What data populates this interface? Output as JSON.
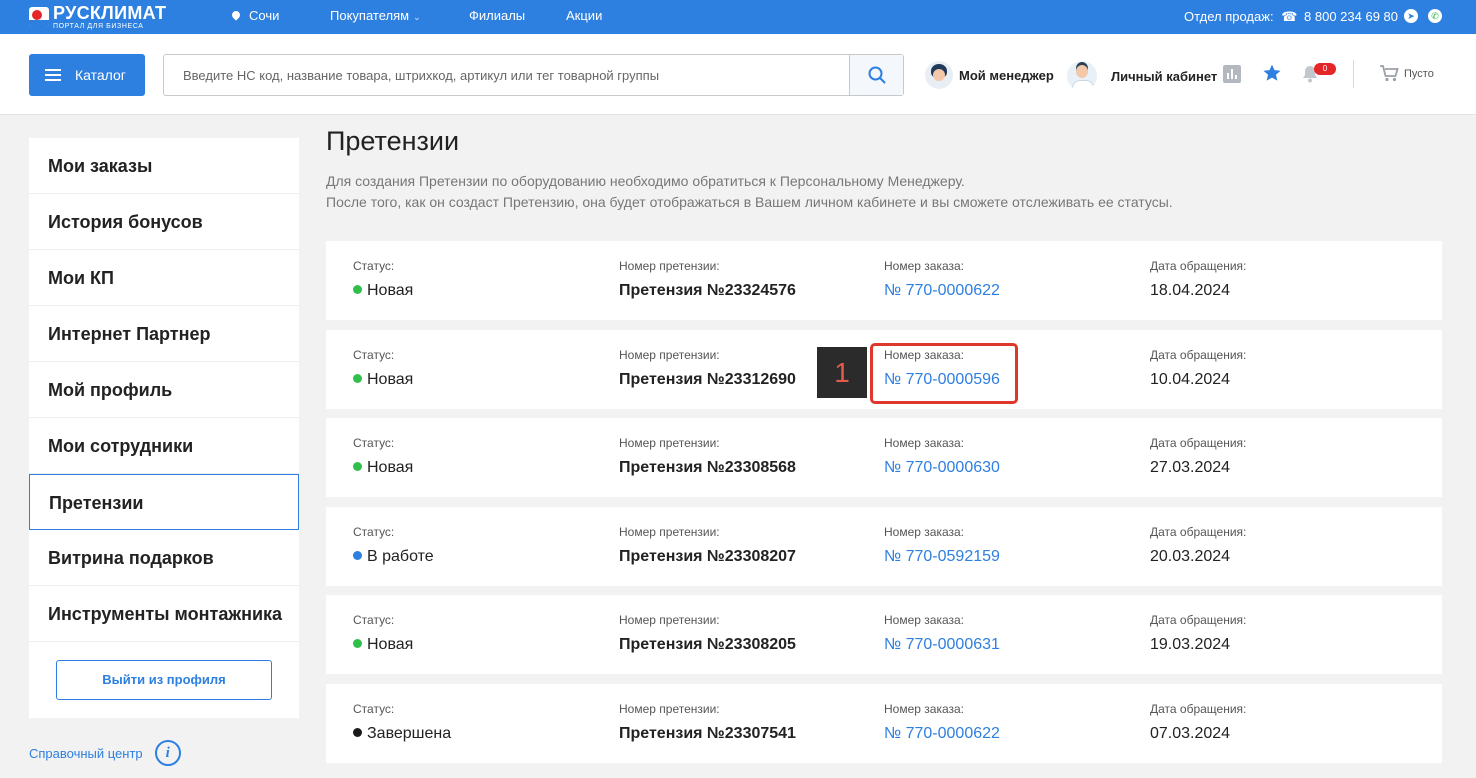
{
  "topbar": {
    "logo_name": "РУСКЛИМАТ",
    "logo_sub": "ПОРТАЛ ДЛЯ БИЗНЕСА",
    "city": "Сочи",
    "buyers": "Покупателям",
    "branches": "Филиалы",
    "promos": "Акции",
    "sales_label": "Отдел продаж:",
    "phone": "8 800 234 69 80",
    "icons": [
      "map-pin-icon",
      "phone-icon",
      "telegram-icon",
      "whatsapp-icon"
    ],
    "bg_color": "#2d7fe0"
  },
  "header": {
    "catalog_label": "Каталог",
    "search_placeholder": "Введите НС код, название товара, штрихкод, артикул или тег товарной группы",
    "manager_label": "Мой менеджер",
    "cabinet_label": "Личный кабинет",
    "notifications_count": "0",
    "cart_label": "Пусто",
    "icons": [
      "menu-icon",
      "search-icon",
      "statistics-icon",
      "star-icon",
      "bell-icon",
      "cart-icon"
    ]
  },
  "sidebar": {
    "items": [
      {
        "label": "Мои заказы"
      },
      {
        "label": "История бонусов"
      },
      {
        "label": "Мои КП"
      },
      {
        "label": "Интернет Партнер"
      },
      {
        "label": "Мой профиль"
      },
      {
        "label": "Мои сотрудники"
      },
      {
        "label": "Претензии",
        "active": true
      },
      {
        "label": "Витрина подарков"
      },
      {
        "label": "Инструменты монтажника"
      }
    ],
    "logout_label": "Выйти из профиля",
    "help_label": "Справочный центр",
    "help_icon_char": "i"
  },
  "main": {
    "title": "Претензии",
    "desc_line1": "Для создания Претензии по оборудованию необходимо обратиться к Персональному Менеджеру.",
    "desc_line2": "После того, как он создаст Претензию, она будет отображаться в Вашем личном кабинете и вы сможете отслеживать ее статусы.",
    "labels": {
      "status": "Статус:",
      "claim_number": "Номер претензии:",
      "order_number": "Номер заказа:",
      "date": "Дата обращения:"
    },
    "status_colors": {
      "Новая": "#2fbf4a",
      "В работе": "#2d7fe0",
      "Завершена": "#1a1a1a"
    },
    "claims": [
      {
        "status": "Новая",
        "claim": "Претензия №23324576",
        "order": "№ 770-0000622",
        "date": "18.04.2024"
      },
      {
        "status": "Новая",
        "claim": "Претензия №23312690",
        "order": "№ 770-0000596",
        "date": "10.04.2024"
      },
      {
        "status": "Новая",
        "claim": "Претензия №23308568",
        "order": "№ 770-0000630",
        "date": "27.03.2024"
      },
      {
        "status": "В работе",
        "claim": "Претензия №23308207",
        "order": "№ 770-0592159",
        "date": "20.03.2024"
      },
      {
        "status": "Новая",
        "claim": "Претензия №23308205",
        "order": "№ 770-0000631",
        "date": "19.03.2024"
      },
      {
        "status": "Завершена",
        "claim": "Претензия №23307541",
        "order": "№ 770-0000622",
        "date": "07.03.2024"
      }
    ]
  },
  "annotation": {
    "label": "1",
    "color": "#e0372c"
  }
}
